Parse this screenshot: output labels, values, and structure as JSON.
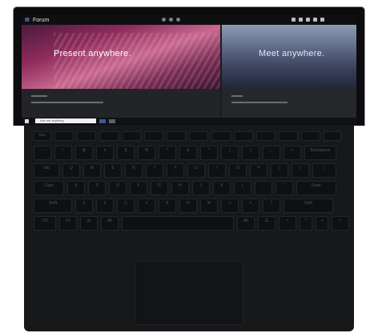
{
  "app": {
    "name": "Forum"
  },
  "slides": {
    "current": "Present anywhere.",
    "next": "Meet anywhere."
  },
  "taskbar": {
    "search_placeholder": "Ask me anything"
  },
  "icons": [
    "forum-logo-icon",
    "windows-start-icon",
    "search-icon"
  ],
  "colors": {
    "accent": "#7fb3ff",
    "slide_left_bg": "#8e2b5c",
    "slide_right_bg": "#5a6583",
    "keyboard": "#17181a"
  },
  "keyboard": {
    "function_row": [
      "Esc",
      "",
      "",
      "",
      "",
      "",
      "",
      "",
      "",
      "",
      "",
      "",
      "",
      ""
    ],
    "row_numbers": [
      "~",
      "!",
      "@",
      "#",
      "$",
      "%",
      "^",
      "&",
      "*",
      "(",
      ")",
      "_",
      "+",
      "Backspace"
    ],
    "row_qwerty": [
      "Tab",
      "Q",
      "W",
      "E",
      "R",
      "T",
      "Y",
      "U",
      "I",
      "O",
      "P",
      "{",
      "}",
      "|"
    ],
    "row_asdf": [
      "Caps",
      "A",
      "S",
      "D",
      "F",
      "G",
      "H",
      "J",
      "K",
      "L",
      ":",
      "\"",
      "Enter"
    ],
    "row_zxcv": [
      "Shift",
      "Z",
      "X",
      "C",
      "V",
      "B",
      "N",
      "M",
      "<",
      ">",
      "?",
      "Shift"
    ],
    "row_bottom": [
      "Ctrl",
      "Fn",
      "⊞",
      "Alt",
      "",
      "Alt",
      "☰",
      "<",
      "^",
      "v",
      ">"
    ]
  }
}
